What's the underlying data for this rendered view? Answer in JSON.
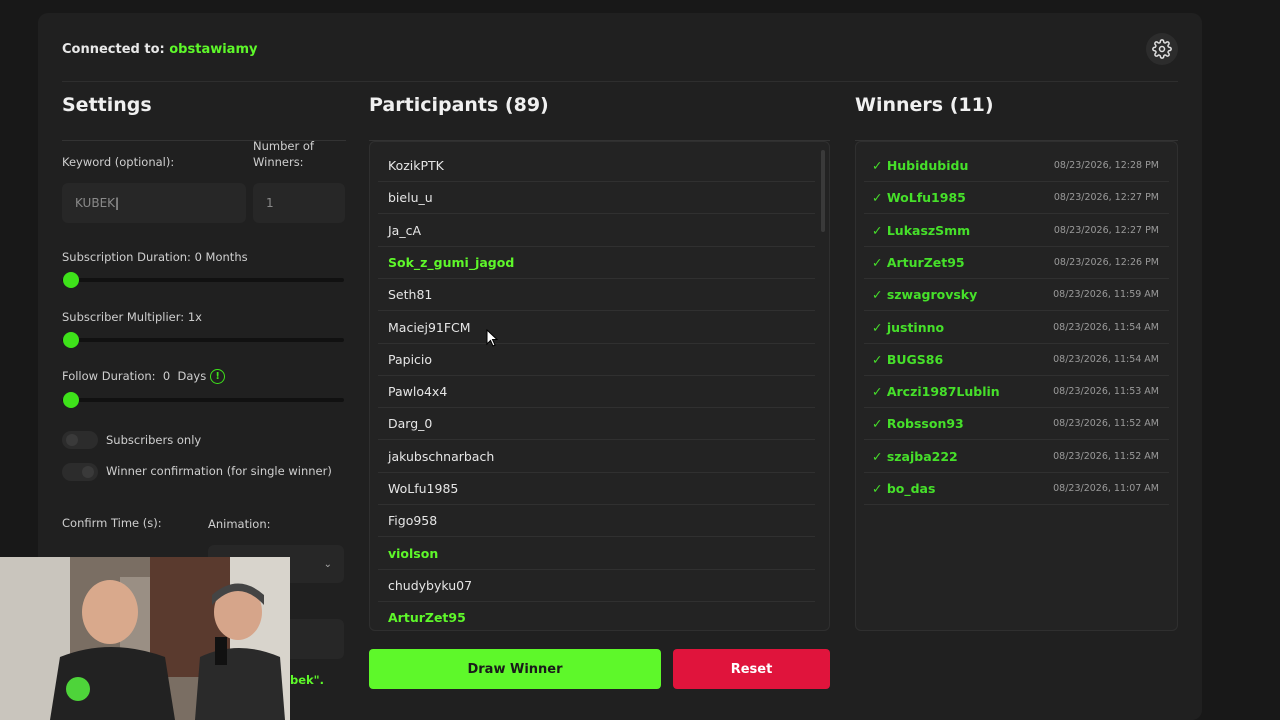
{
  "header": {
    "connected_label": "Connected to:",
    "channel": "obstawiamy"
  },
  "settings": {
    "title": "Settings",
    "keyword_label": "Keyword (optional):",
    "keyword_value": "KUBEK",
    "winners_label": "Number of Winners:",
    "winners_value": "1",
    "sub_duration_label": "Subscription Duration: 0 Months",
    "sub_multiplier_label": "Subscriber Multiplier: 1x",
    "follow_label": "Follow Duration:  0  Days",
    "subs_only_label": "Subscribers only",
    "winner_conf_label": "Winner confirmation (for single winner)",
    "confirm_time_label": "Confirm Time (s):",
    "animation_label": "Animation:",
    "partial_text": "bek\"."
  },
  "participants": {
    "title": "Participants (89)",
    "items": [
      {
        "name": "KozikPTK",
        "hl": false
      },
      {
        "name": "bielu_u",
        "hl": false
      },
      {
        "name": "Ja_cA",
        "hl": false
      },
      {
        "name": "Sok_z_gumi_jagod",
        "hl": true
      },
      {
        "name": "Seth81",
        "hl": false
      },
      {
        "name": "Maciej91FCM",
        "hl": false
      },
      {
        "name": "Papicio",
        "hl": false
      },
      {
        "name": "Pawlo4x4",
        "hl": false
      },
      {
        "name": "Darg_0",
        "hl": false
      },
      {
        "name": "jakubschnarbach",
        "hl": false
      },
      {
        "name": "WoLfu1985",
        "hl": false
      },
      {
        "name": "Figo958",
        "hl": false
      },
      {
        "name": "violson",
        "hl": true
      },
      {
        "name": "chudybyku07",
        "hl": false
      },
      {
        "name": "ArturZet95",
        "hl": true
      }
    ]
  },
  "winners": {
    "title": "Winners (11)",
    "items": [
      {
        "name": "✓ Hubidubidu",
        "date": "08/23/2026, 12:28 PM"
      },
      {
        "name": "✓ WoLfu1985",
        "date": "08/23/2026, 12:27 PM"
      },
      {
        "name": "✓ LukaszSmm",
        "date": "08/23/2026, 12:27 PM"
      },
      {
        "name": "✓ ArturZet95",
        "date": "08/23/2026, 12:26 PM"
      },
      {
        "name": "✓ szwagrovsky",
        "date": "08/23/2026, 11:59 AM"
      },
      {
        "name": "✓ justinno",
        "date": "08/23/2026, 11:54 AM"
      },
      {
        "name": "✓ BUGS86",
        "date": "08/23/2026, 11:54 AM"
      },
      {
        "name": "✓ Arczi1987Lublin",
        "date": "08/23/2026, 11:53 AM"
      },
      {
        "name": "✓ Robsson93",
        "date": "08/23/2026, 11:52 AM"
      },
      {
        "name": "✓ szajba222",
        "date": "08/23/2026, 11:52 AM"
      },
      {
        "name": "✓ bo_das",
        "date": "08/23/2026, 11:07 AM"
      }
    ]
  },
  "buttons": {
    "draw": "Draw Winner",
    "reset": "Reset"
  },
  "colors": {
    "accent": "#5ef82a",
    "reset": "#e0143c",
    "bg": "#202020"
  }
}
